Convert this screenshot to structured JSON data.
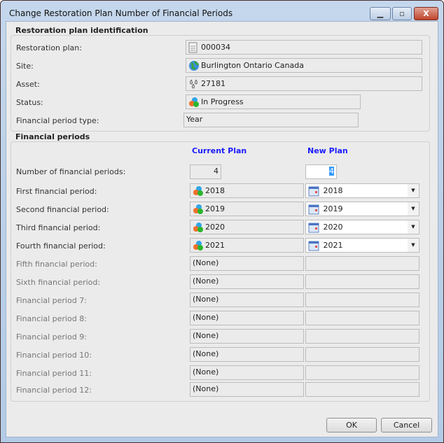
{
  "window": {
    "title": "Change Restoration Plan Number of Financial Periods",
    "minimize": "▁",
    "maximize": "▫",
    "close": "X"
  },
  "identification": {
    "legend": "Restoration plan identification",
    "rows": [
      {
        "label": "Restoration plan:",
        "value": "000034",
        "icon": "document-icon"
      },
      {
        "label": "Site:",
        "value": "Burlington Ontario Canada",
        "icon": "globe-icon"
      },
      {
        "label": "Asset:",
        "value": "27181",
        "icon": "asset-drops-icon"
      },
      {
        "label": "Status:",
        "value": "In Progress",
        "icon": "status-balls-icon"
      },
      {
        "label": "Financial period type:",
        "value": "Year"
      }
    ]
  },
  "periods": {
    "legend": "Financial periods",
    "current_header": "Current Plan",
    "new_header": "New Plan",
    "count_label": "Number of financial periods:",
    "current_count": "4",
    "new_count": "4",
    "rows": [
      {
        "label": "First financial period:",
        "current": "2018",
        "new": "2018"
      },
      {
        "label": "Second financial period:",
        "current": "2019",
        "new": "2019"
      },
      {
        "label": "Third financial period:",
        "current": "2020",
        "new": "2020"
      },
      {
        "label": "Fourth financial period:",
        "current": "2021",
        "new": "2021"
      },
      {
        "label": "Fifth financial period:",
        "current": "(None)",
        "new": ""
      },
      {
        "label": "Sixth financial period:",
        "current": "(None)",
        "new": ""
      },
      {
        "label": "Financial period 7:",
        "current": "(None)",
        "new": ""
      },
      {
        "label": "Financial period 8:",
        "current": "(None)",
        "new": ""
      },
      {
        "label": "Financial period 9:",
        "current": "(None)",
        "new": ""
      },
      {
        "label": "Financial period 10:",
        "current": "(None)",
        "new": ""
      },
      {
        "label": "Financial period 11:",
        "current": "(None)",
        "new": ""
      },
      {
        "label": "Financial period 12:",
        "current": "(None)",
        "new": ""
      }
    ]
  },
  "buttons": {
    "ok": "OK",
    "cancel": "Cancel"
  }
}
